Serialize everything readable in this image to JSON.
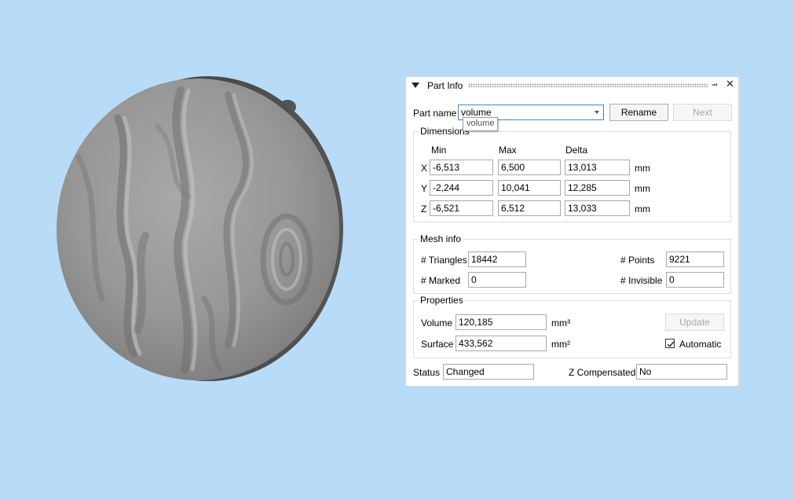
{
  "panel": {
    "title": "Part Info",
    "part_name_label": "Part name",
    "part_name_value": "volume",
    "part_name_tooltip": "volume",
    "rename_label": "Rename",
    "next_label": "Next"
  },
  "dimensions": {
    "title": "Dimensions",
    "col_min": "Min",
    "col_max": "Max",
    "col_delta": "Delta",
    "rows": [
      {
        "axis": "X",
        "min": "-6,513",
        "max": "6,500",
        "delta": "13,013",
        "unit": "mm"
      },
      {
        "axis": "Y",
        "min": "-2,244",
        "max": "10,041",
        "delta": "12,285",
        "unit": "mm"
      },
      {
        "axis": "Z",
        "min": "-6,521",
        "max": "6,512",
        "delta": "13,033",
        "unit": "mm"
      }
    ]
  },
  "mesh_info": {
    "title": "Mesh info",
    "triangles_label": "# Triangles",
    "triangles_value": "18442",
    "points_label": "# Points",
    "points_value": "9221",
    "marked_label": "# Marked",
    "marked_value": "0",
    "invisible_label": "# Invisible",
    "invisible_value": "0"
  },
  "properties": {
    "title": "Properties",
    "volume_label": "Volume",
    "volume_value": "120,185",
    "volume_unit": "mm³",
    "surface_label": "Surface",
    "surface_value": "433,562",
    "surface_unit": "mm²",
    "update_label": "Update",
    "automatic_label": "Automatic",
    "automatic_checked": true
  },
  "status": {
    "status_label": "Status",
    "status_value": "Changed",
    "z_comp_label": "Z Compensated",
    "z_comp_value": "No"
  },
  "colors": {
    "background": "#b8dcf7",
    "model_gray": "#8a8a8a",
    "focus_border": "#3a86d6"
  }
}
